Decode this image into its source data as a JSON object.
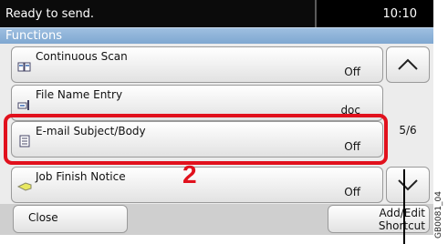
{
  "status": {
    "message": "Ready to send.",
    "time": "10:10"
  },
  "title": "Functions",
  "items": [
    {
      "label": "Continuous Scan",
      "value": "Off",
      "icon": "continuous-scan-icon"
    },
    {
      "label": "File Name Entry",
      "value": "doc",
      "icon": "file-name-icon"
    },
    {
      "label": "E-mail Subject/Body",
      "value": "Off",
      "icon": "email-icon"
    },
    {
      "label": "Job Finish Notice",
      "value": "Off",
      "icon": "notice-icon"
    }
  ],
  "pager": {
    "page": "5/6"
  },
  "callout": "2",
  "buttons": {
    "close": "Close",
    "shortcut_line1": "Add/Edit",
    "shortcut_line2": "Shortcut"
  },
  "reference_code": "GB0081_04",
  "colors": {
    "highlight": "#e1111d",
    "title_bar": "#8fb3d9"
  }
}
